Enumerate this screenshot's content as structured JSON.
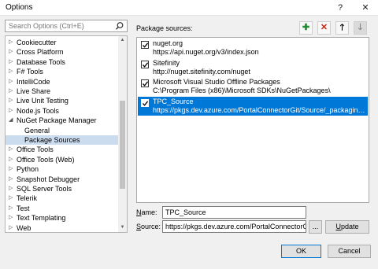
{
  "window": {
    "title": "Options",
    "help_glyph": "?",
    "close_glyph": "✕"
  },
  "search": {
    "placeholder": "Search Options (Ctrl+E)"
  },
  "tree": {
    "items": [
      {
        "label": "Cookiecutter",
        "expander": "▷"
      },
      {
        "label": "Cross Platform",
        "expander": "▷"
      },
      {
        "label": "Database Tools",
        "expander": "▷"
      },
      {
        "label": "F# Tools",
        "expander": "▷"
      },
      {
        "label": "IntelliCode",
        "expander": "▷"
      },
      {
        "label": "Live Share",
        "expander": "▷"
      },
      {
        "label": "Live Unit Testing",
        "expander": "▷"
      },
      {
        "label": "Node.js Tools",
        "expander": "▷"
      },
      {
        "label": "NuGet Package Manager",
        "expander": "◢"
      },
      {
        "label": "General",
        "expander": ""
      },
      {
        "label": "Package Sources",
        "expander": ""
      },
      {
        "label": "Office Tools",
        "expander": "▷"
      },
      {
        "label": "Office Tools (Web)",
        "expander": "▷"
      },
      {
        "label": "Python",
        "expander": "▷"
      },
      {
        "label": "Snapshot Debugger",
        "expander": "▷"
      },
      {
        "label": "SQL Server Tools",
        "expander": "▷"
      },
      {
        "label": "Telerik",
        "expander": "▷"
      },
      {
        "label": "Test",
        "expander": "▷"
      },
      {
        "label": "Text Templating",
        "expander": "▷"
      },
      {
        "label": "Web",
        "expander": "▷"
      }
    ],
    "selected_index": 10
  },
  "panel": {
    "label": "Package sources:",
    "tools": {
      "add": "✚",
      "remove": "✕",
      "up": "🡑",
      "down": "🡓"
    },
    "colors": {
      "add": "#1e8b2e",
      "remove": "#c42b1c",
      "selection": "#0078d7"
    },
    "sources": [
      {
        "name": "nuget.org",
        "url": "https://api.nuget.org/v3/index.json",
        "checked": true
      },
      {
        "name": "Sitefinity",
        "url": "http://nuget.sitefinity.com/nuget",
        "checked": true
      },
      {
        "name": "Microsoft Visual Studio Offline Packages",
        "url": "C:\\Program Files (x86)\\Microsoft SDKs\\NuGetPackages\\",
        "checked": true
      },
      {
        "name": "TPC_Source",
        "url": "https://pkgs.dev.azure.com/PortalConnectorGit/Source/_packaging/Po...",
        "checked": true
      }
    ],
    "selected_index": 3
  },
  "form": {
    "name_label_key": "N",
    "name_label_rest": "ame:",
    "name_value": "TPC_Source",
    "source_label_key": "S",
    "source_label_rest": "ource:",
    "source_value": "https://pkgs.dev.azure.com/PortalConnectorGit/S",
    "browse_label": "...",
    "update_label_key": "U",
    "update_label_rest": "pdate"
  },
  "footer": {
    "ok_label": "OK",
    "cancel_label": "Cancel"
  }
}
